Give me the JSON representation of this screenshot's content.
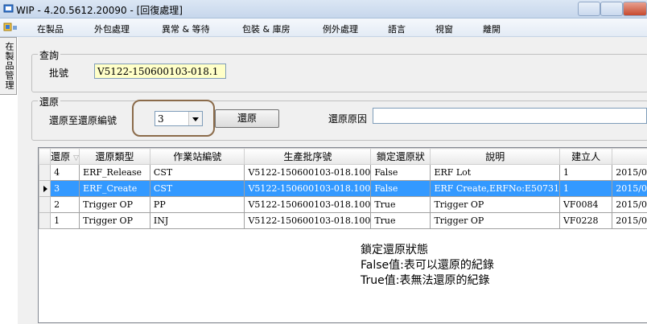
{
  "window": {
    "title": "WIP - 4.20.5612.20090 - [回復處理]"
  },
  "menu": {
    "items": [
      "在製品",
      "外包處理",
      "異常 & 等待",
      "包裝 & 庫房",
      "例外處理",
      "語言",
      "視窗",
      "離開"
    ]
  },
  "side_tab": {
    "label": "在製品管理"
  },
  "query_group": {
    "title": "查詢",
    "lot_label": "批號",
    "lot_value": "V5122-150600103-018.1"
  },
  "restore_group": {
    "title": "還原",
    "restore_to_label": "還原至還原編號",
    "restore_to_value": "3",
    "restore_button": "還原",
    "reason_label": "還原原因",
    "reason_value": ""
  },
  "grid": {
    "columns": [
      "還原",
      "還原類型",
      "作業站編號",
      "生產批序號",
      "鎖定還原狀",
      "說明",
      "建立人",
      ""
    ],
    "rows": [
      [
        "4",
        "ERF_Release",
        "CST",
        "V5122-150600103-018.100",
        "False",
        "ERF Lot",
        "1",
        "2015/0"
      ],
      [
        "3",
        "ERF_Create",
        "CST",
        "V5122-150600103-018.100",
        "False",
        "ERF Create,ERFNo:E50731",
        "1",
        "2015/0"
      ],
      [
        "2",
        "Trigger OP",
        "PP",
        "V5122-150600103-018.100",
        "True",
        "Trigger OP",
        "VF0084",
        "2015/0"
      ],
      [
        "1",
        "Trigger OP",
        "INJ",
        "V5122-150600103-018.100",
        "True",
        "Trigger OP",
        "VF0228",
        "2015/0"
      ]
    ],
    "selected_row": 1
  },
  "note": {
    "line1": "鎖定還原狀態",
    "line2": "False值:表可以還原的紀錄",
    "line3": "True值:表無法還原的紀錄"
  },
  "colors": {
    "selection": "#3399ff",
    "lot_input_bg": "#ffffc8",
    "highlight_ring": "#8b6b4a"
  }
}
